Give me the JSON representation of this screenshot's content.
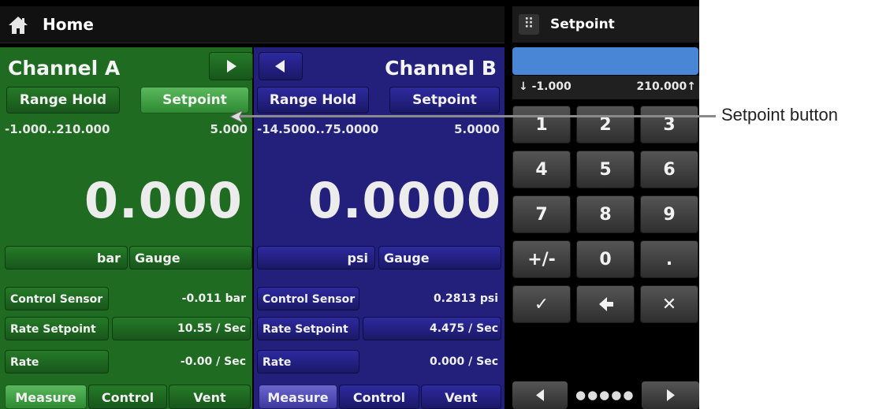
{
  "header": {
    "title": "Home",
    "icon": "home-icon"
  },
  "channel_a": {
    "title": "Channel A",
    "range_hold_label": "Range Hold",
    "setpoint_label": "Setpoint",
    "range": "-1.000..210.000",
    "setpoint_value": "5.000",
    "reading": "0.000",
    "unit": "bar",
    "mode": "Gauge",
    "rows": [
      {
        "label": "Control Sensor",
        "value": "-0.011 bar"
      },
      {
        "label": "Rate Setpoint",
        "value": "10.55 / Sec"
      },
      {
        "label": "Rate",
        "value": "-0.00 / Sec"
      }
    ],
    "tabs": [
      "Measure",
      "Control",
      "Vent"
    ],
    "color": "#1f6b22"
  },
  "channel_b": {
    "title": "Channel B",
    "range_hold_label": "Range Hold",
    "setpoint_label": "Setpoint",
    "range": "-14.5000..75.0000",
    "setpoint_value": "5.0000",
    "reading": "0.0000",
    "unit": "psi",
    "mode": "Gauge",
    "rows": [
      {
        "label": "Control Sensor",
        "value": "0.2813 psi"
      },
      {
        "label": "Rate Setpoint",
        "value": "4.475 / Sec"
      },
      {
        "label": "Rate",
        "value": "0.000 / Sec"
      }
    ],
    "tabs": [
      "Measure",
      "Control",
      "Vent"
    ],
    "color": "#22207a"
  },
  "keypad": {
    "title": "Setpoint",
    "min": "↓ -1.000",
    "max": "210.000↑",
    "keys": [
      "1",
      "2",
      "3",
      "4",
      "5",
      "6",
      "7",
      "8",
      "9",
      "+/-",
      "0",
      ".",
      "✓",
      "🡐",
      "✕"
    ],
    "pager_dots": "●●●●●",
    "accent": "#4a86d6"
  },
  "annotation": {
    "label": "Setpoint button"
  }
}
